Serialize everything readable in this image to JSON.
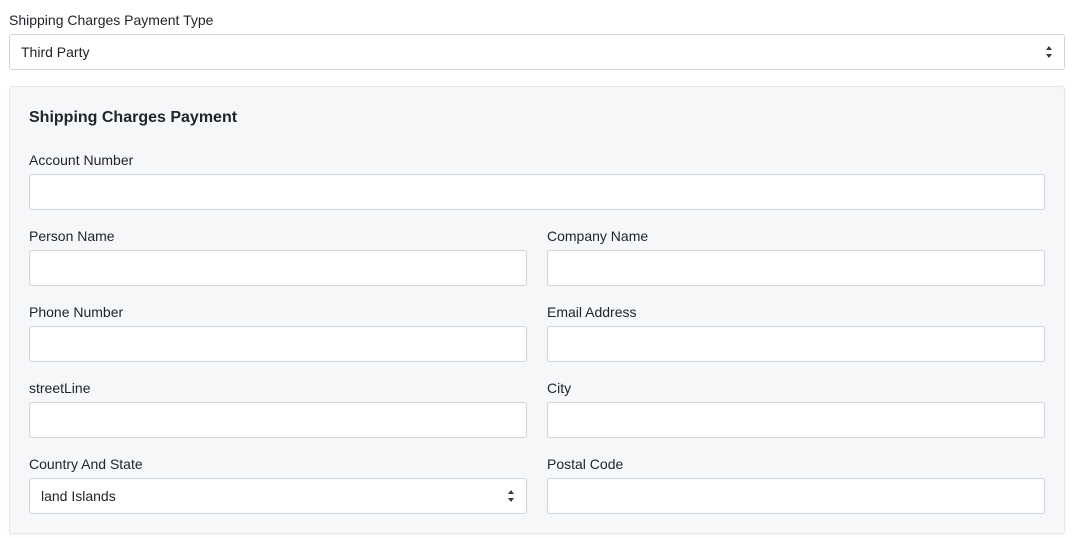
{
  "payment_type": {
    "label": "Shipping Charges Payment Type",
    "selected": "Third Party"
  },
  "panel": {
    "title": "Shipping Charges Payment",
    "account_number": {
      "label": "Account Number",
      "value": ""
    },
    "person_name": {
      "label": "Person Name",
      "value": ""
    },
    "company_name": {
      "label": "Company Name",
      "value": ""
    },
    "phone_number": {
      "label": "Phone Number",
      "value": ""
    },
    "email_address": {
      "label": "Email Address",
      "value": ""
    },
    "street_line": {
      "label": "streetLine",
      "value": ""
    },
    "city": {
      "label": "City",
      "value": ""
    },
    "country_state": {
      "label": "Country And State",
      "selected": "land Islands"
    },
    "postal_code": {
      "label": "Postal Code",
      "value": ""
    }
  },
  "icons": {
    "select_caret": "up-down-caret-icon"
  },
  "colors": {
    "panel_background": "#f6f7f9",
    "input_border": "#ced4da",
    "text": "#212529"
  }
}
